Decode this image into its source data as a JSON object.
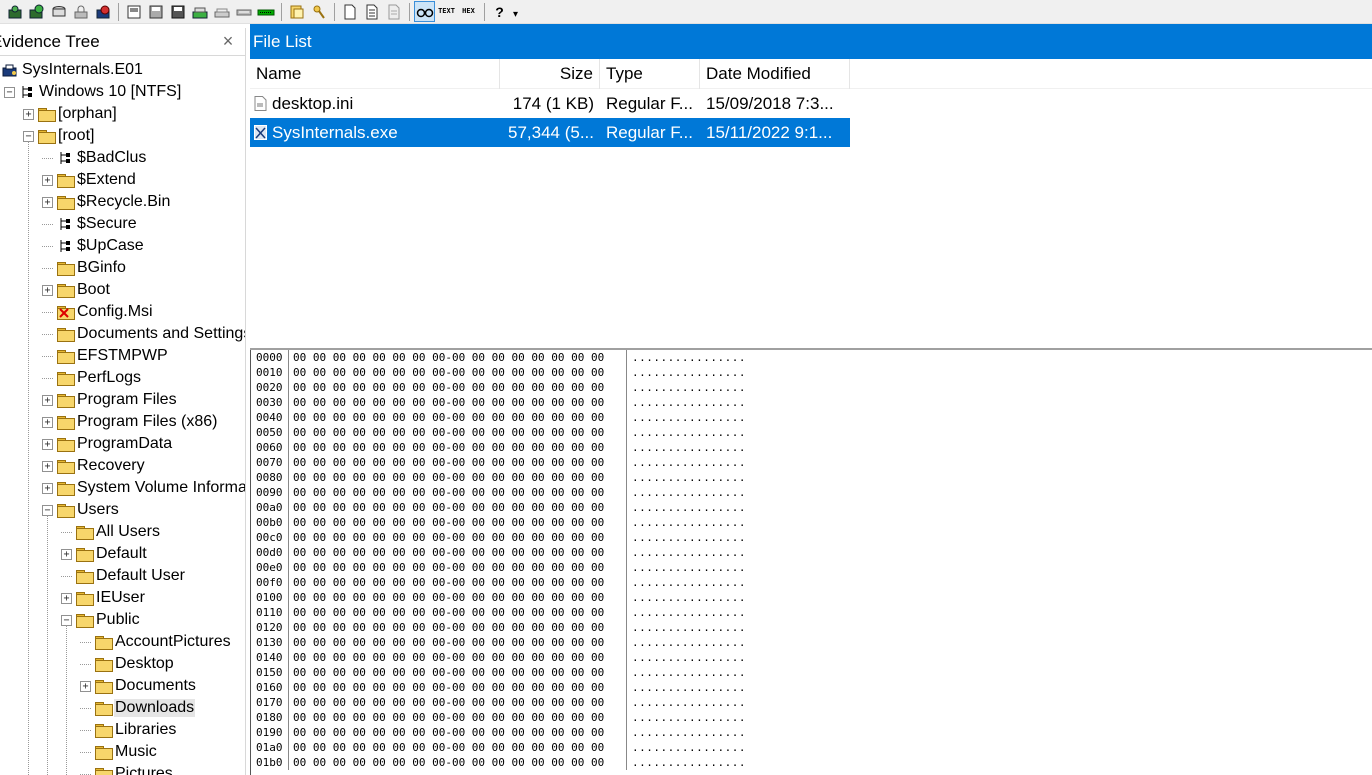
{
  "toolbar": {
    "buttons": [
      "add-evidence-icon",
      "add-all-evidence-icon",
      "image-mounting-icon",
      "decrypt-icon",
      "remove-evidence-icon",
      "create-image-icon",
      "export-files-icon",
      "export-directory-icon",
      "capture-memory-icon",
      "obtain-protected-files-icon",
      "detect-encrypted-icon",
      "verify-drive-icon",
      "custom-content-icon",
      "view-files-icon",
      "text-view-icon",
      "hex-view-icon",
      "help-icon"
    ],
    "text_label": "TEXT",
    "hex_label": "HEX",
    "help_glyph": "?",
    "dropdown_glyph": "▾"
  },
  "evidence_tree": {
    "title": "Evidence Tree",
    "close_glyph": "×"
  },
  "tree": [
    {
      "label": "SysInternals.E01",
      "depth": 0,
      "expander": "",
      "icon": "evidence-icon"
    },
    {
      "label": "Windows 10 [NTFS]",
      "depth": 0,
      "expander": "−",
      "icon": "partition-icon"
    },
    {
      "label": "[orphan]",
      "depth": 1,
      "expander": "+",
      "icon": "folder-icon"
    },
    {
      "label": "[root]",
      "depth": 1,
      "expander": "−",
      "icon": "folder-icon"
    },
    {
      "label": "$BadClus",
      "depth": 2,
      "expander": "",
      "icon": "system-file-icon"
    },
    {
      "label": "$Extend",
      "depth": 2,
      "expander": "+",
      "icon": "folder-icon"
    },
    {
      "label": "$Recycle.Bin",
      "depth": 2,
      "expander": "+",
      "icon": "folder-icon"
    },
    {
      "label": "$Secure",
      "depth": 2,
      "expander": "",
      "icon": "system-file-icon"
    },
    {
      "label": "$UpCase",
      "depth": 2,
      "expander": "",
      "icon": "system-file-icon"
    },
    {
      "label": "BGinfo",
      "depth": 2,
      "expander": "",
      "icon": "folder-icon"
    },
    {
      "label": "Boot",
      "depth": 2,
      "expander": "+",
      "icon": "folder-icon"
    },
    {
      "label": "Config.Msi",
      "depth": 2,
      "expander": "",
      "icon": "deleted-folder-icon"
    },
    {
      "label": "Documents and Settings",
      "depth": 2,
      "expander": "",
      "icon": "folder-icon"
    },
    {
      "label": "EFSTMPWP",
      "depth": 2,
      "expander": "",
      "icon": "folder-icon"
    },
    {
      "label": "PerfLogs",
      "depth": 2,
      "expander": "",
      "icon": "folder-icon"
    },
    {
      "label": "Program Files",
      "depth": 2,
      "expander": "+",
      "icon": "folder-icon"
    },
    {
      "label": "Program Files (x86)",
      "depth": 2,
      "expander": "+",
      "icon": "folder-icon"
    },
    {
      "label": "ProgramData",
      "depth": 2,
      "expander": "+",
      "icon": "folder-icon"
    },
    {
      "label": "Recovery",
      "depth": 2,
      "expander": "+",
      "icon": "folder-icon"
    },
    {
      "label": "System Volume Informa",
      "depth": 2,
      "expander": "+",
      "icon": "folder-icon"
    },
    {
      "label": "Users",
      "depth": 2,
      "expander": "−",
      "icon": "folder-icon"
    },
    {
      "label": "All Users",
      "depth": 3,
      "expander": "",
      "icon": "folder-icon"
    },
    {
      "label": "Default",
      "depth": 3,
      "expander": "+",
      "icon": "folder-icon"
    },
    {
      "label": "Default User",
      "depth": 3,
      "expander": "",
      "icon": "folder-icon"
    },
    {
      "label": "IEUser",
      "depth": 3,
      "expander": "+",
      "icon": "folder-icon"
    },
    {
      "label": "Public",
      "depth": 3,
      "expander": "−",
      "icon": "folder-icon"
    },
    {
      "label": "AccountPictures",
      "depth": 4,
      "expander": "",
      "icon": "folder-icon"
    },
    {
      "label": "Desktop",
      "depth": 4,
      "expander": "",
      "icon": "folder-icon"
    },
    {
      "label": "Documents",
      "depth": 4,
      "expander": "+",
      "icon": "folder-icon"
    },
    {
      "label": "Downloads",
      "depth": 4,
      "expander": "",
      "icon": "folder-icon",
      "selected": true
    },
    {
      "label": "Libraries",
      "depth": 4,
      "expander": "",
      "icon": "folder-icon"
    },
    {
      "label": "Music",
      "depth": 4,
      "expander": "",
      "icon": "folder-icon"
    },
    {
      "label": "Pictures",
      "depth": 4,
      "expander": "",
      "icon": "folder-icon"
    }
  ],
  "file_list": {
    "title": "File List",
    "columns": {
      "name": "Name",
      "size": "Size",
      "type": "Type",
      "date": "Date Modified"
    },
    "rows": [
      {
        "name": "desktop.ini",
        "size": "174 (1 KB)",
        "type": "Regular F...",
        "date": "15/09/2018 7:3...",
        "icon": "file-icon",
        "selected": false
      },
      {
        "name": "SysInternals.exe",
        "size": "57,344 (5...",
        "type": "Regular F...",
        "date": "15/11/2022 9:1...",
        "icon": "executable-icon",
        "selected": true
      }
    ]
  },
  "hex_view": {
    "bytes": "00 00 00 00 00 00 00 00-00 00 00 00 00 00 00 00",
    "ascii": "................",
    "offsets": [
      "0000",
      "0010",
      "0020",
      "0030",
      "0040",
      "0050",
      "0060",
      "0070",
      "0080",
      "0090",
      "00a0",
      "00b0",
      "00c0",
      "00d0",
      "00e0",
      "00f0",
      "0100",
      "0110",
      "0120",
      "0130",
      "0140",
      "0150",
      "0160",
      "0170",
      "0180",
      "0190",
      "01a0",
      "01b0"
    ]
  },
  "colors": {
    "accent": "#0078d7",
    "selection_bg": "#0078d7",
    "tree_selection_bg": "#e5e5e5"
  }
}
